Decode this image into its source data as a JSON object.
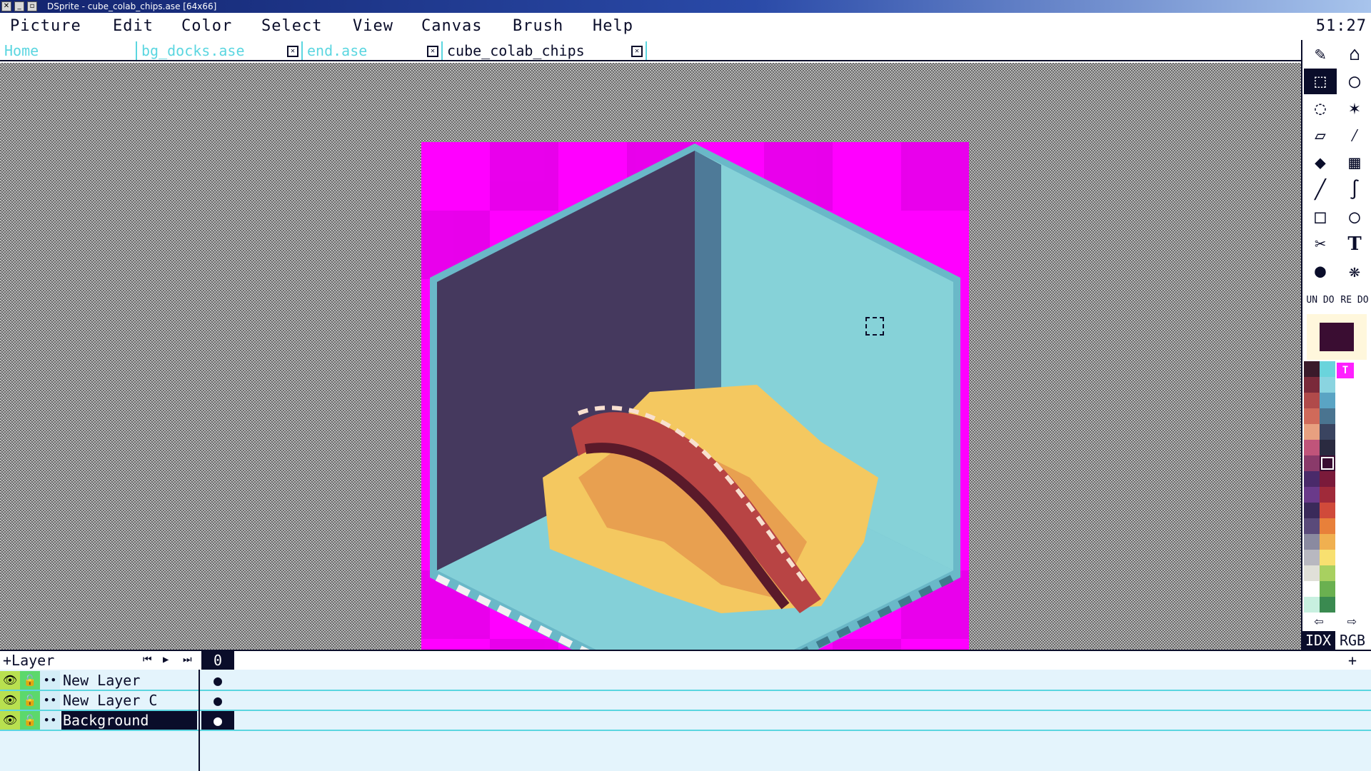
{
  "window": {
    "title": "DSprite - cube_colab_chips.ase [64x66]"
  },
  "menubar": {
    "items": [
      "Picture",
      "Edit",
      "Color",
      "Select",
      "View",
      "Canvas",
      "Brush",
      "Help"
    ],
    "clock": "51:27"
  },
  "tabs": [
    {
      "label": "Home"
    },
    {
      "label": "bg_docks.ase"
    },
    {
      "label": "end.ase"
    },
    {
      "label": "cube_colab_chips"
    }
  ],
  "toolbar": {
    "undo": "UN DO",
    "redo": "RE DO",
    "text_tool": "T",
    "fg_color": "#3a0d32",
    "mode_idx": "IDX",
    "mode_rgb": "RGB"
  },
  "palette": [
    "#3a1a2a",
    "#6ad4dc",
    "#7a2a3a",
    "#8ad4e0",
    "#b04a4a",
    "#5aa4c4",
    "#d06a5a",
    "#4a7490",
    "#e8a080",
    "#3a4460",
    "#c0547a",
    "#2a2a40",
    "#8a3a6a",
    "#3a0d32",
    "#4a2a6a",
    "#7a1a3a",
    "#6a3a8a",
    "#a02a3a",
    "#3a2a5a",
    "#d04a3a",
    "#5a4a7a",
    "#e8803a",
    "#8a8aa0",
    "#f0b050",
    "#b8b8c0",
    "#f8e070",
    "#e0e0d8",
    "#a8d060",
    "#ffffff",
    "#6ab050",
    "#c8f0e0",
    "#3a8a50"
  ],
  "timeline": {
    "add_layer": "+Layer",
    "frame": "0",
    "frame_add": "+",
    "layers": [
      {
        "name": "New Layer",
        "cel": "●"
      },
      {
        "name": "New Layer C",
        "cel": "●"
      },
      {
        "name": "Background",
        "cel": "●"
      }
    ]
  }
}
